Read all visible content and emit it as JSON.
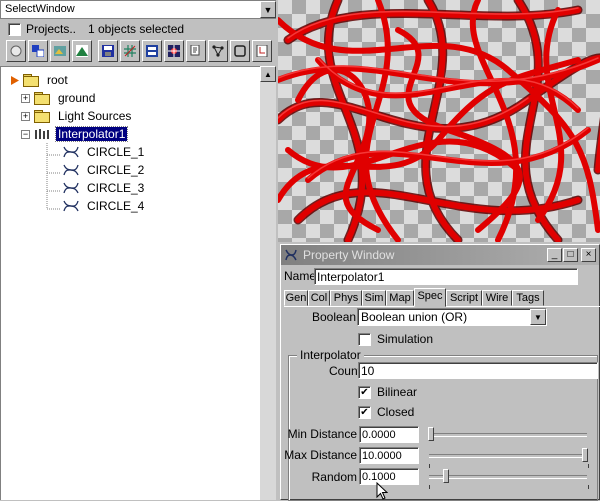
{
  "select_window": {
    "title": "SelectWindow",
    "dropdown_arrow": "▼",
    "projects_label": "Projects..",
    "projects_checked": false,
    "objects_selected": "1 objects selected",
    "toolbar_icons": [
      "sphere-icon",
      "layers-icon",
      "scene-icon",
      "mountain-icon",
      "save-icon",
      "grid-icon",
      "panel-icon",
      "star-icon",
      "cut-icon",
      "network-icon",
      "frame-icon",
      "page-icon"
    ],
    "scroll_up_arrow": "▲"
  },
  "tree": {
    "root": "root",
    "ground": "ground",
    "light_sources": "Light Sources",
    "interpolator": "Interpolator1",
    "circles": [
      "CIRCLE_1",
      "CIRCLE_2",
      "CIRCLE_3",
      "CIRCLE_4"
    ]
  },
  "property_window": {
    "title": "Property Window",
    "name_label": "Name",
    "name_value": "Interpolator1",
    "tabs": [
      "Gen",
      "Col",
      "Phys",
      "Sim",
      "Map",
      "Spec",
      "Script",
      "Wire",
      "Tags"
    ],
    "active_tab": "Spec",
    "boolean_label": "Boolean",
    "boolean_value": "Boolean union (OR)",
    "simulation_label": "Simulation",
    "simulation_checked": false,
    "interpolator_group": "Interpolator",
    "count_label": "Count",
    "count_value": "10",
    "bilinear_label": "Bilinear",
    "bilinear_checked": true,
    "closed_label": "Closed",
    "closed_checked": true,
    "min_distance_label": "Min Distance",
    "min_distance_value": "0.0000",
    "max_distance_label": "Max Distance",
    "max_distance_value": "10.0000",
    "random_label": "Random",
    "random_value": "0.1000"
  },
  "colors": {
    "selection": "#000080",
    "strands": "#e00000",
    "background": "#c0c0c0"
  }
}
